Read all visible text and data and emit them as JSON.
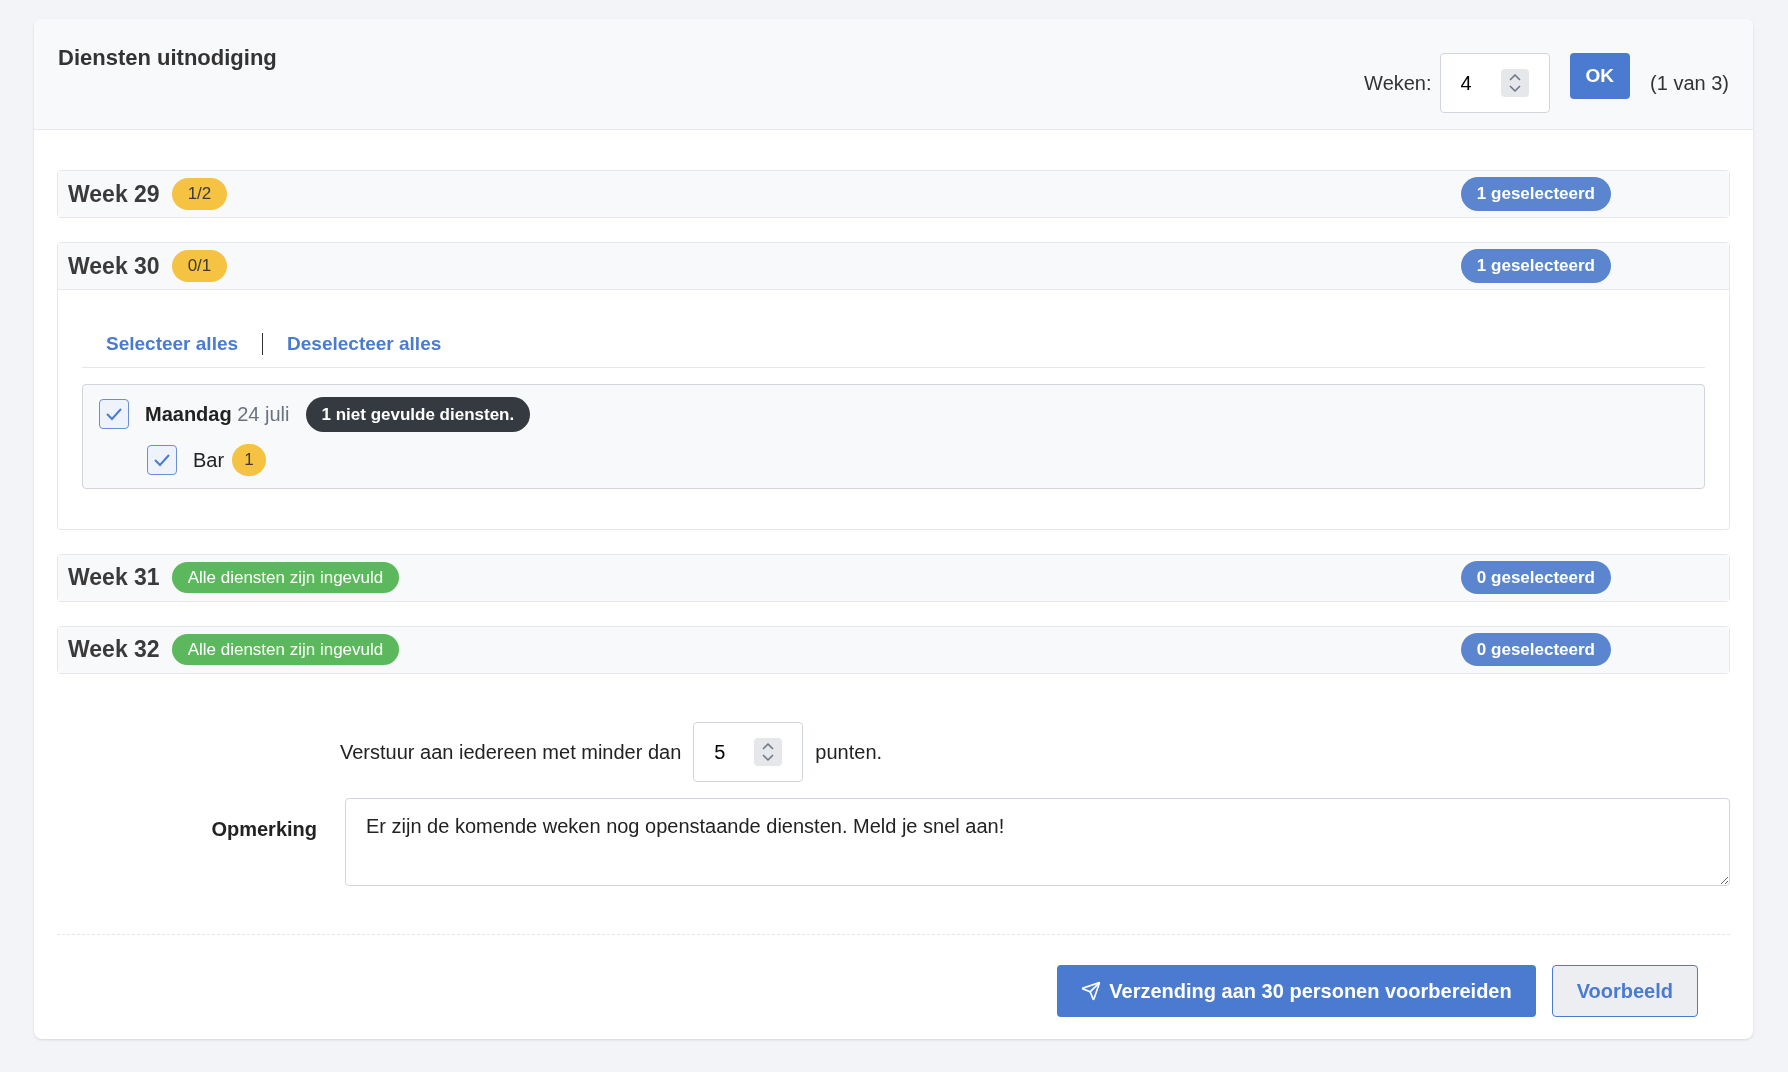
{
  "header": {
    "title": "Diensten uitnodiging",
    "weeks_label": "Weken:",
    "weeks_value": "4",
    "ok_button": "OK",
    "page_info": "(1 van 3)"
  },
  "weeks": [
    {
      "label": "Week 29",
      "badge": {
        "kind": "partial",
        "text": "1/2"
      },
      "selected_count": "1 geselecteerd",
      "expanded": false
    },
    {
      "label": "Week 30",
      "badge": {
        "kind": "partial",
        "text": "0/1"
      },
      "selected_count": "1 geselecteerd",
      "expanded": true,
      "select_all": "Selecteer alles",
      "deselect_all": "Deselecteer alles",
      "days": [
        {
          "name": "Maandag",
          "date": "24 juli",
          "checked": true,
          "badge": "1 niet gevulde diensten.",
          "shifts": [
            {
              "name": "Bar",
              "checked": true,
              "count": "1"
            }
          ]
        }
      ]
    },
    {
      "label": "Week 31",
      "badge": {
        "kind": "done",
        "text": "Alle diensten zijn ingevuld"
      },
      "selected_count": "0 geselecteerd",
      "expanded": false
    },
    {
      "label": "Week 32",
      "badge": {
        "kind": "done",
        "text": "Alle diensten zijn ingevuld"
      },
      "selected_count": "0 geselecteerd",
      "expanded": false
    }
  ],
  "points": {
    "before": "Verstuur aan iedereen met minder dan",
    "value": "5",
    "after": "punten."
  },
  "remark": {
    "label": "Opmerking",
    "value": "Er zijn de komende weken nog openstaande diensten. Meld je snel aan!"
  },
  "buttons": {
    "send": "Verzending aan 30 personen voorbereiden",
    "preview": "Voorbeeld"
  }
}
